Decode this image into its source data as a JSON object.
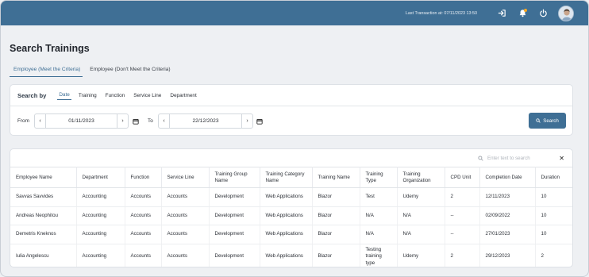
{
  "topbar": {
    "last_transaction": "Last Transaction at: 07/11/2023 13:50"
  },
  "page": {
    "title": "Search Trainings",
    "tabs": [
      "Employee (Meet the Criteria)",
      "Employee (Don't Meet the Criteria)"
    ],
    "active_tab": 0
  },
  "search": {
    "search_by_label": "Search by",
    "tabs": [
      "Date",
      "Training",
      "Function",
      "Service Line",
      "Department"
    ],
    "active_tab": 0,
    "from_label": "From",
    "from_value": "01/11/2023",
    "to_label": "To",
    "to_value": "22/12/2023",
    "button_label": "Search"
  },
  "table": {
    "search_placeholder": "Enter text to search",
    "columns": [
      "Employee Name",
      "Department",
      "Function",
      "Service Line",
      "Training Group Name",
      "Training Category Name",
      "Training Name",
      "Training Type",
      "Training Organization",
      "CPD Unit",
      "Completion Date",
      "Duration"
    ],
    "rows": [
      [
        "Savvas Savvides",
        "Accounting",
        "Accounts",
        "Accounts",
        "Development",
        "Web Applications",
        "Blazor",
        "Test",
        "Udemy",
        "2",
        "12/11/2023",
        "10"
      ],
      [
        "Andreas Neophitou",
        "Accounting",
        "Accounts",
        "Accounts",
        "Development",
        "Web Applications",
        "Blazor",
        "N/A",
        "N/A",
        "--",
        "02/09/2022",
        "10"
      ],
      [
        "Demetris Kneknos",
        "Accounting",
        "Accounts",
        "Accounts",
        "Development",
        "Web Applications",
        "Blazor",
        "N/A",
        "N/A",
        "--",
        "27/01/2023",
        "10"
      ],
      [
        "Iulia Angelescu",
        "Accounting",
        "Accounts",
        "Accounts",
        "Development",
        "Web Applications",
        "Blazor",
        "Testing training type",
        "Udemy",
        "2",
        "29/12/2023",
        "2"
      ]
    ]
  },
  "colors": {
    "primary": "#3f6f95",
    "background": "#eef0f3",
    "notification": "#f5a623"
  },
  "icons": [
    "login-icon",
    "bell-icon",
    "power-icon",
    "user-avatar",
    "chevron-left-icon",
    "chevron-right-icon",
    "calendar-icon",
    "search-icon",
    "close-icon"
  ]
}
